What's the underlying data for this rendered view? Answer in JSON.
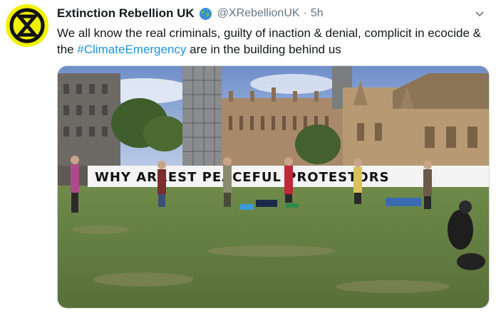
{
  "account": {
    "display_name": "Extinction Rebellion UK",
    "handle": "@XRebellionUK",
    "separator": "·",
    "time": "5h",
    "verified_emoji": "globe-icon"
  },
  "tweet": {
    "text_before": "We all know the real criminals, guilty of inaction & denial, complicit in ecocide & the ",
    "hashtag": "#ClimateEmergency",
    "text_after": " are in the building behind us"
  },
  "media": {
    "banner": "WHY ARREST PEACEFUL PROTESTORS"
  },
  "colors": {
    "brand": "#f0f000",
    "link": "#1b95e0",
    "muted": "#657786"
  }
}
